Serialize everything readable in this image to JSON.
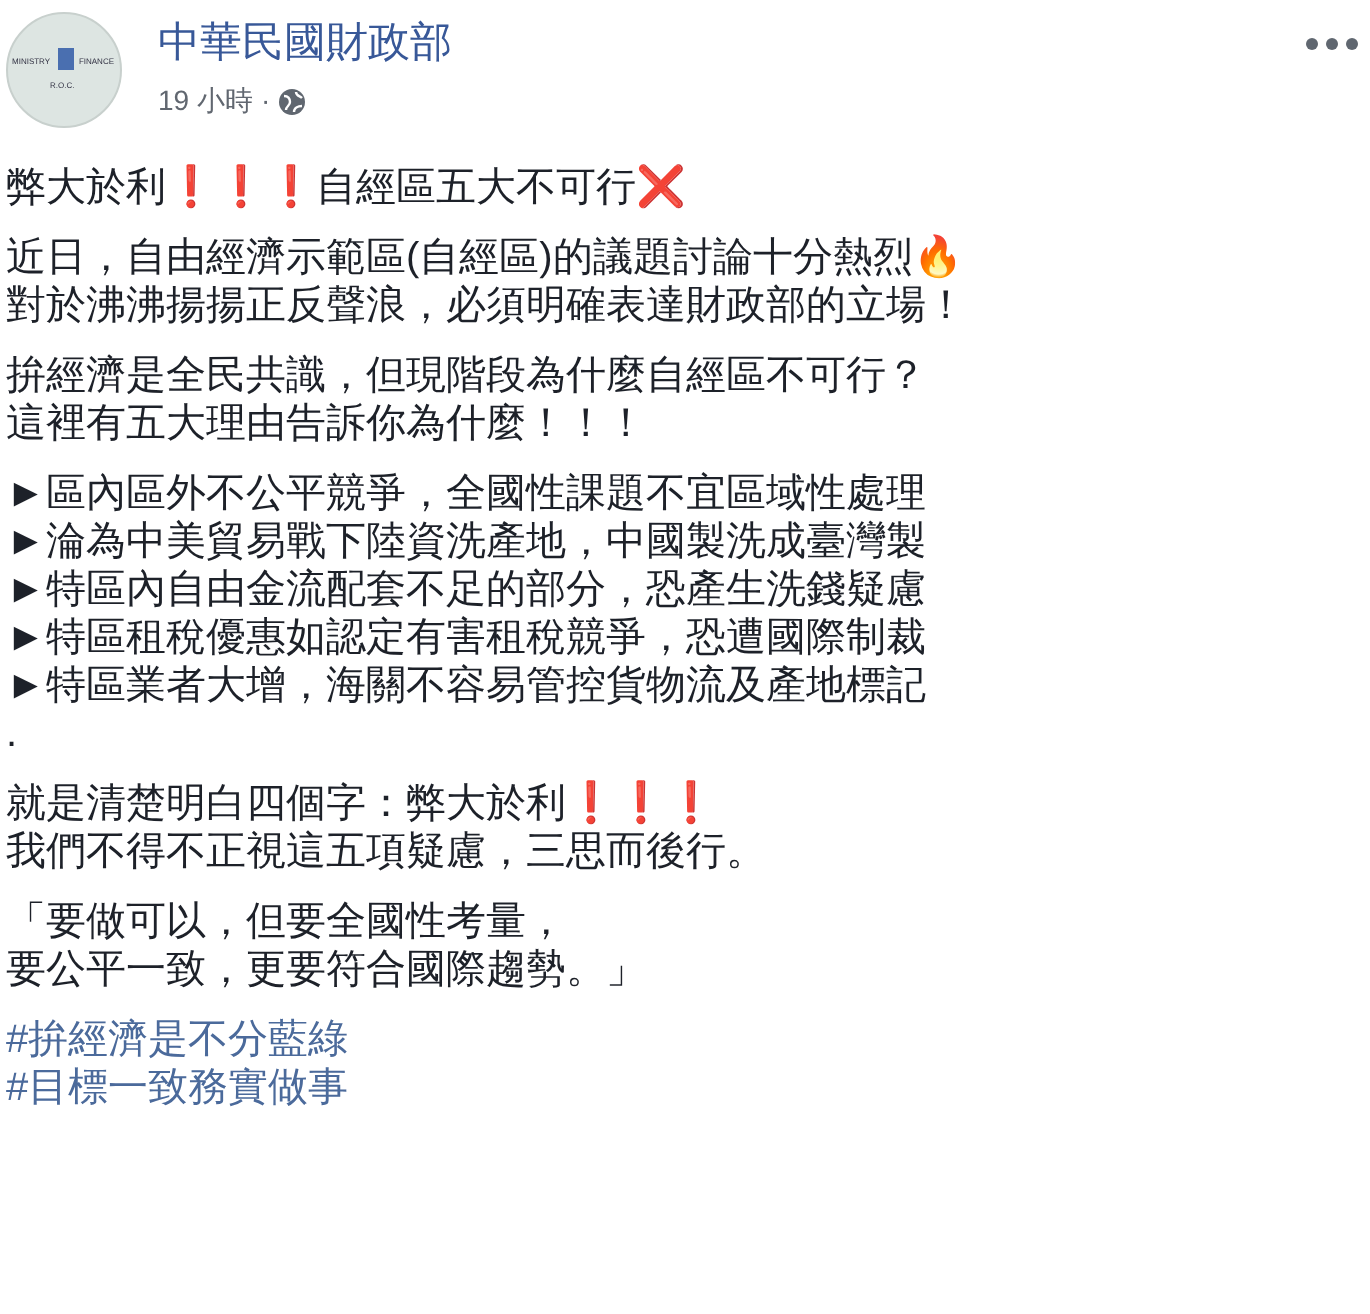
{
  "post": {
    "author": "中華民國財政部",
    "time": "19 小時",
    "separator": "·",
    "avatar": {
      "left": "MINISTRY",
      "right": "FINANCE",
      "bottom": "R.O.C."
    },
    "paragraphs": [
      {
        "lines": [
          "弊大於利❗❗❗自經區五大不可行❌"
        ]
      },
      {
        "lines": [
          "近日，自由經濟示範區(自經區)的議題討論十分熱烈🔥",
          "對於沸沸揚揚正反聲浪，必須明確表達財政部的立場！"
        ]
      },
      {
        "lines": [
          "拚經濟是全民共識，但現階段為什麼自經區不可行？",
          "這裡有五大理由告訴你為什麼！！！"
        ]
      },
      {
        "lines": [
          "►區內區外不公平競爭，全國性課題不宜區域性處理",
          "►淪為中美貿易戰下陸資洗產地，中國製洗成臺灣製",
          "►特區內自由金流配套不足的部分，恐產生洗錢疑慮",
          "►特區租稅優惠如認定有害租稅競爭，恐遭國際制裁",
          "►特區業者大增，海關不容易管控貨物流及產地標記",
          "."
        ]
      },
      {
        "lines": [
          "就是清楚明白四個字：弊大於利❗❗❗",
          "我們不得不正視這五項疑慮，三思而後行。"
        ]
      },
      {
        "lines": [
          "「要做可以，但要全國性考量，",
          "要公平一致，更要符合國際趨勢。」"
        ]
      }
    ],
    "hashtags": [
      "#拚經濟是不分藍綠",
      "#目標一致務實做事"
    ]
  }
}
